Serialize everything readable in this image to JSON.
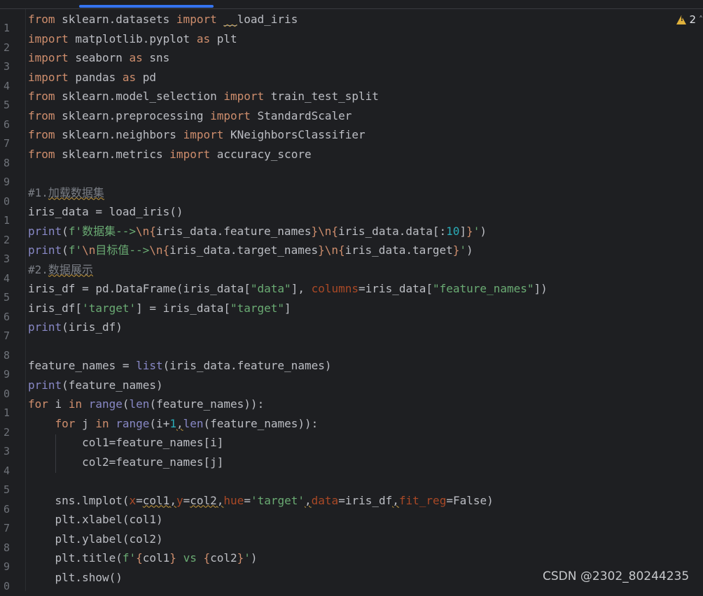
{
  "editor": {
    "line_numbers": [
      "1",
      "2",
      "3",
      "4",
      "5",
      "6",
      "7",
      "8",
      "9",
      "0",
      "1",
      "2",
      "3",
      "4",
      "5",
      "6",
      "7",
      "8",
      "9",
      "0",
      "1",
      "2",
      "3",
      "4",
      "5",
      "6",
      "7",
      "8",
      "9",
      "0"
    ],
    "lines": {
      "l1": [
        "from",
        " sklearn.datasets ",
        "import",
        " ",
        "__",
        "load_iris"
      ],
      "l2": [
        "import",
        " matplotlib.pyplot ",
        "as",
        " plt"
      ],
      "l3": [
        "import",
        " seaborn ",
        "as",
        " sns"
      ],
      "l4": [
        "import",
        " pandas ",
        "as",
        " pd"
      ],
      "l5": [
        "from",
        " sklearn.model_selection ",
        "import",
        " train_test_split"
      ],
      "l6": [
        "from",
        " sklearn.preprocessing ",
        "import",
        " StandardScaler"
      ],
      "l7": [
        "from",
        " sklearn.neighbors ",
        "import",
        " KNeighborsClassifier"
      ],
      "l8": [
        "from",
        " sklearn.metrics ",
        "import",
        " accuracy_score"
      ],
      "l10": [
        "#1.",
        "加载数据集"
      ],
      "l11": [
        "iris_data = load_iris()"
      ],
      "l12": [
        "print",
        "(",
        "f'",
        "数据集",
        "-->",
        "\\n",
        "{",
        "iris_data.feature_names",
        "}",
        "\\n",
        "{",
        "iris_data.data[:",
        "10",
        "]",
        "}",
        "'",
        ")"
      ],
      "l13": [
        "print",
        "(",
        "f'",
        "\\n",
        "目标值",
        "-->",
        "\\n",
        "{",
        "iris_data.target_names",
        "}",
        "\\n",
        "{",
        "iris_data.target",
        "}",
        "'",
        ")"
      ],
      "l14": [
        "#2.",
        "数据展示"
      ],
      "l15": [
        "iris_df = pd.DataFrame(iris_data[",
        "\"data\"",
        "], ",
        "columns",
        "=iris_data[",
        "\"feature_names\"",
        "])"
      ],
      "l16": [
        "iris_df[",
        "'target'",
        "] = iris_data[",
        "\"target\"",
        "]"
      ],
      "l17": [
        "print",
        "(iris_df)"
      ],
      "l19": [
        "feature_names = ",
        "list",
        "(iris_data.feature_names)"
      ],
      "l20": [
        "print",
        "(feature_names)"
      ],
      "l21": [
        "for",
        " i ",
        "in",
        " ",
        "range",
        "(",
        "len",
        "(feature_names)):"
      ],
      "l22": [
        "    ",
        "for",
        " j ",
        "in",
        " ",
        "range",
        "(i+",
        "1",
        ",",
        "len",
        "(feature_names)):"
      ],
      "l23": [
        "        col1=feature_names[i]"
      ],
      "l24": [
        "        col2=feature_names[j]"
      ],
      "l26": [
        "    sns.lmplot(",
        "x",
        "=",
        "col1",
        ",",
        "y",
        "=",
        "col2",
        ",",
        "hue",
        "=",
        "'target'",
        ",",
        "data",
        "=iris_df",
        ",",
        "fit_reg",
        "=False)"
      ],
      "l27": [
        "    plt.xlabel(col1)"
      ],
      "l28": [
        "    plt.ylabel(col2)"
      ],
      "l29": [
        "    plt.title(",
        "f'",
        "{",
        "col1",
        "}",
        " vs ",
        "{",
        "col2",
        "}",
        "'",
        ")"
      ],
      "l30": [
        "    plt.show()"
      ]
    }
  },
  "inspection": {
    "count": "2",
    "icon": "warning-icon",
    "chevron": "˄"
  },
  "watermark": "CSDN @2302_80244235",
  "colors": {
    "background": "#1e1f22",
    "keyword": "#cf8e6d",
    "string": "#6aab73",
    "number": "#2aacb8",
    "builtin": "#8888c6",
    "param": "#aa4926",
    "comment": "#7a7e85",
    "accent": "#3574f0"
  }
}
